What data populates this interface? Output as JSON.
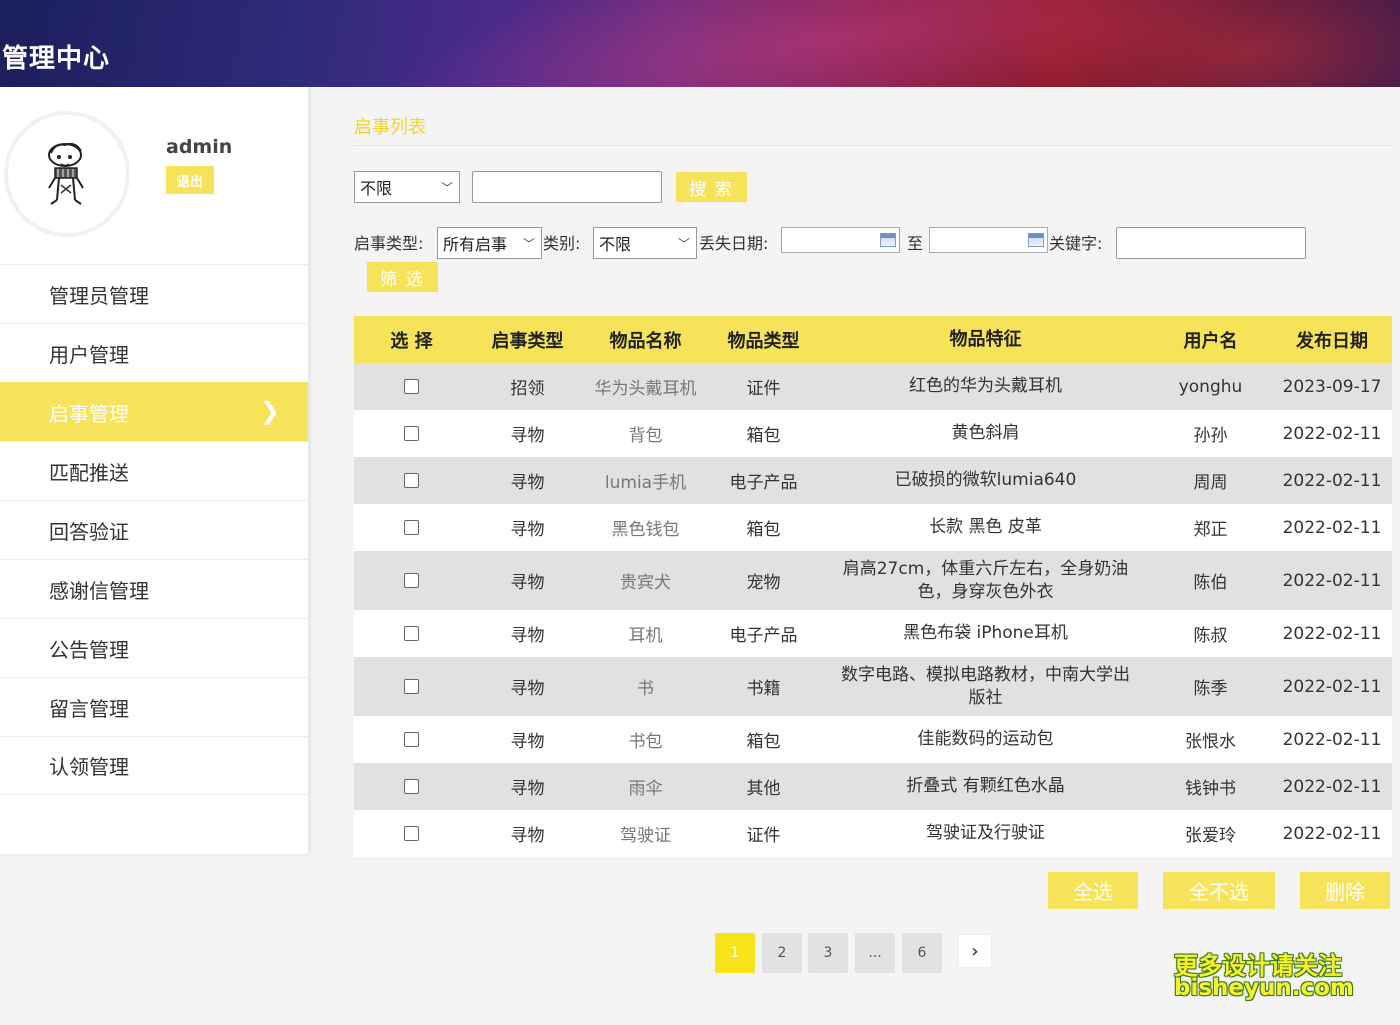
{
  "header": {
    "title": "管理中心"
  },
  "sidebar": {
    "username": "admin",
    "logout_label": "退出",
    "items": [
      {
        "label": "管理员管理",
        "active": false
      },
      {
        "label": "用户管理",
        "active": false
      },
      {
        "label": "启事管理",
        "active": true
      },
      {
        "label": "匹配推送",
        "active": false
      },
      {
        "label": "回答验证",
        "active": false
      },
      {
        "label": "感谢信管理",
        "active": false
      },
      {
        "label": "公告管理",
        "active": false
      },
      {
        "label": "留言管理",
        "active": false
      },
      {
        "label": "认领管理",
        "active": false
      }
    ]
  },
  "main": {
    "section_title": "启事列表",
    "search": {
      "select_value": "不限",
      "input_value": "",
      "button_label": "搜 索"
    },
    "filters": {
      "notice_type_label": "启事类型:",
      "notice_type_value": "所有启事",
      "category_label": "类别:",
      "category_value": "不限",
      "lost_date_label": "丢失日期:",
      "date_from": "",
      "to_label": "至",
      "date_to": "",
      "keyword_label": "关键字:",
      "keyword_value": "",
      "filter_button_label": "筛 选"
    },
    "table": {
      "headers": [
        "选 择",
        "启事类型",
        "物品名称",
        "物品类型",
        "物品特征",
        "用户名",
        "发布日期"
      ],
      "rows": [
        {
          "type": "招领",
          "name": "华为头戴耳机",
          "category": "证件",
          "feature": "红色的华为头戴耳机",
          "user": "yonghu",
          "date": "2023-09-17"
        },
        {
          "type": "寻物",
          "name": "背包",
          "category": "箱包",
          "feature": "黄色斜肩",
          "user": "孙孙",
          "date": "2022-02-11"
        },
        {
          "type": "寻物",
          "name": "lumia手机",
          "category": "电子产品",
          "feature": "已破损的微软lumia640",
          "user": "周周",
          "date": "2022-02-11"
        },
        {
          "type": "寻物",
          "name": "黑色钱包",
          "category": "箱包",
          "feature": "长款 黑色 皮革",
          "user": "郑正",
          "date": "2022-02-11"
        },
        {
          "type": "寻物",
          "name": "贵宾犬",
          "category": "宠物",
          "feature": "肩高27cm，体重六斤左右，全身奶油色，身穿灰色外衣",
          "user": "陈伯",
          "date": "2022-02-11"
        },
        {
          "type": "寻物",
          "name": "耳机",
          "category": "电子产品",
          "feature": "黑色布袋 iPhone耳机",
          "user": "陈叔",
          "date": "2022-02-11"
        },
        {
          "type": "寻物",
          "name": "书",
          "category": "书籍",
          "feature": "数字电路、模拟电路教材，中南大学出版社",
          "user": "陈季",
          "date": "2022-02-11"
        },
        {
          "type": "寻物",
          "name": "书包",
          "category": "箱包",
          "feature": "佳能数码的运动包",
          "user": "张恨水",
          "date": "2022-02-11"
        },
        {
          "type": "寻物",
          "name": "雨伞",
          "category": "其他",
          "feature": "折叠式 有颗红色水晶",
          "user": "钱钟书",
          "date": "2022-02-11"
        },
        {
          "type": "寻物",
          "name": "驾驶证",
          "category": "证件",
          "feature": "驾驶证及行驶证",
          "user": "张爱玲",
          "date": "2022-02-11"
        }
      ]
    },
    "actions": {
      "select_all": "全选",
      "select_none": "全不选",
      "delete": "删除"
    },
    "pagination": {
      "pages": [
        "1",
        "2",
        "3",
        "...",
        "6"
      ],
      "current": "1",
      "next_label": "›"
    }
  },
  "watermark": {
    "line1": "更多设计请关注",
    "line2": "bisheyun.com"
  }
}
